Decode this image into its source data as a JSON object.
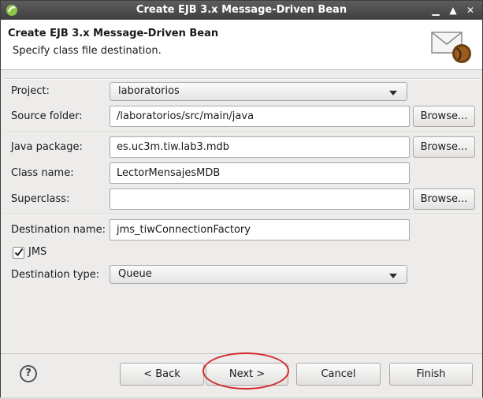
{
  "window": {
    "title": "Create EJB 3.x Message-Driven Bean"
  },
  "header": {
    "title": "Create EJB 3.x Message-Driven Bean",
    "subtitle": "Specify class file destination."
  },
  "form": {
    "project": {
      "label": "Project:",
      "value": "laboratorios"
    },
    "source_folder": {
      "label": "Source folder:",
      "value": "/laboratorios/src/main/java",
      "button": "Browse..."
    },
    "java_package": {
      "label": "Java package:",
      "value": "es.uc3m.tiw.lab3.mdb",
      "button": "Browse..."
    },
    "class_name": {
      "label": "Class name:",
      "value": "LectorMensajesMDB"
    },
    "superclass": {
      "label": "Superclass:",
      "value": "",
      "button": "Browse..."
    },
    "destination_name": {
      "label": "Destination name:",
      "value": "jms_tiwConnectionFactory"
    },
    "jms": {
      "label": "JMS",
      "checked": true
    },
    "destination_type": {
      "label": "Destination type:",
      "value": "Queue"
    }
  },
  "buttons": {
    "help": "?",
    "back": "< Back",
    "next": "Next >",
    "cancel": "Cancel",
    "finish": "Finish"
  },
  "colors": {
    "titlebar": "#4a4a4a",
    "dialog_bg": "#edeceb",
    "highlight_circle": "#d22a2a"
  }
}
